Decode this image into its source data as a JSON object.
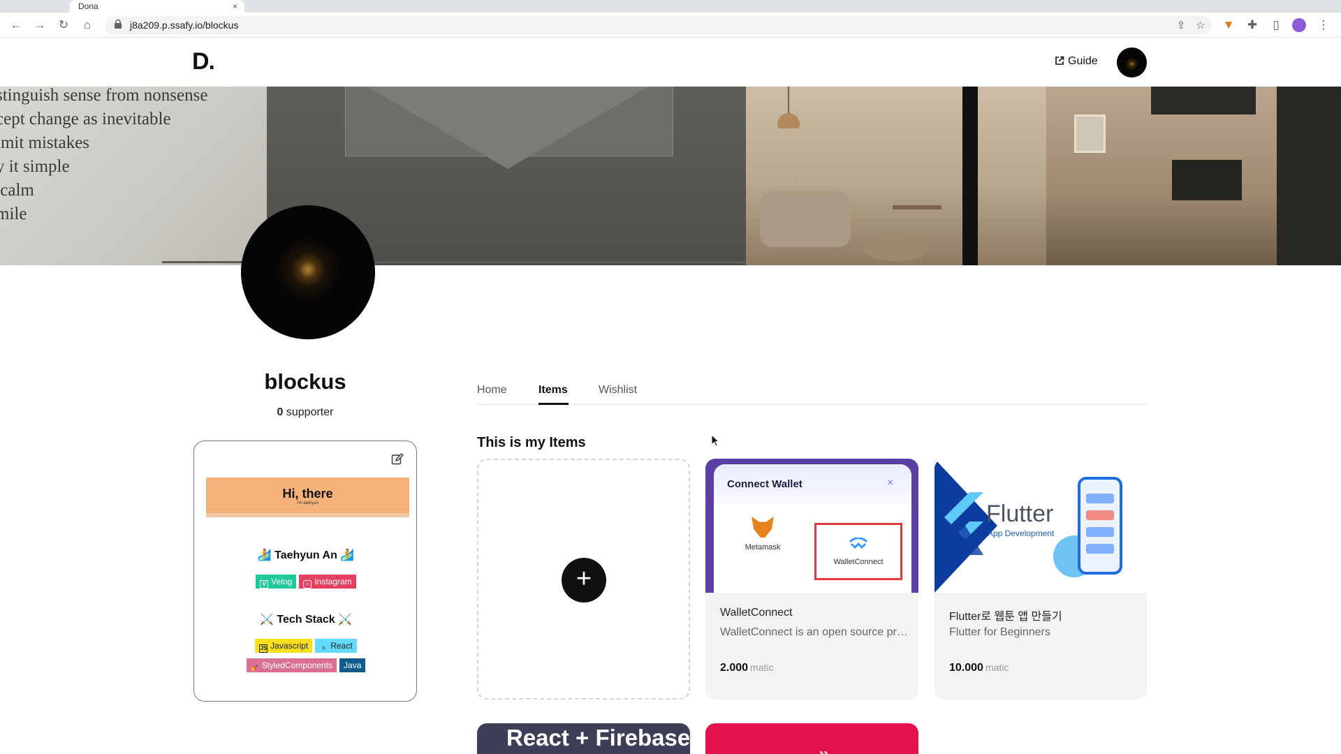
{
  "browser": {
    "tab_title": "Dona",
    "url": "j8a209.p.ssafy.io/blockus"
  },
  "header": {
    "logo": "D.",
    "guide_label": "Guide"
  },
  "banner": {
    "quote_lines": "stinguish sense from nonsense\ncept change as inevitable\nlmit mistakes\ny it simple\n calm\nmile"
  },
  "profile": {
    "username": "blockus",
    "supporter_count": "0",
    "supporter_label": " supporter"
  },
  "about": {
    "hi_title": "Hi, there",
    "hi_sub": "I'm taehyun",
    "person": "🏄 Taehyun An 🏄",
    "social_badges": [
      "Velog",
      "Instagram"
    ],
    "techstack_title": "⚔️ Tech Stack ⚔️",
    "tech_badges": [
      "Javascript",
      "React",
      "StyledComponents",
      "Java"
    ]
  },
  "tabs": [
    "Home",
    "Items",
    "Wishlist"
  ],
  "active_tab": "Items",
  "section_title": "This is my Items",
  "items": [
    {
      "name": "WalletConnect",
      "description": "WalletConnect is an open source protocol",
      "price": "2.000",
      "unit": "matic",
      "thumb": {
        "title": "Connect Wallet",
        "close": "×",
        "option1": "Metamask",
        "option2": "WalletConnect"
      }
    },
    {
      "name": "Flutter로 웹툰 앱 만들기",
      "description": "Flutter for Beginners",
      "price": "10.000",
      "unit": "matic",
      "thumb": {
        "brand": "Flutter",
        "subtitle": "App Development"
      }
    }
  ],
  "bottom_cards": [
    {
      "label": "React + Firebase"
    },
    {
      "label": "»"
    }
  ],
  "colors": {
    "accent": "#111111",
    "velog": "#20c997",
    "instagram": "#e4405f",
    "javascript": "#f7df1e",
    "react": "#61dafb",
    "styled_components": "#db7093",
    "java": "#0f5b8c"
  }
}
